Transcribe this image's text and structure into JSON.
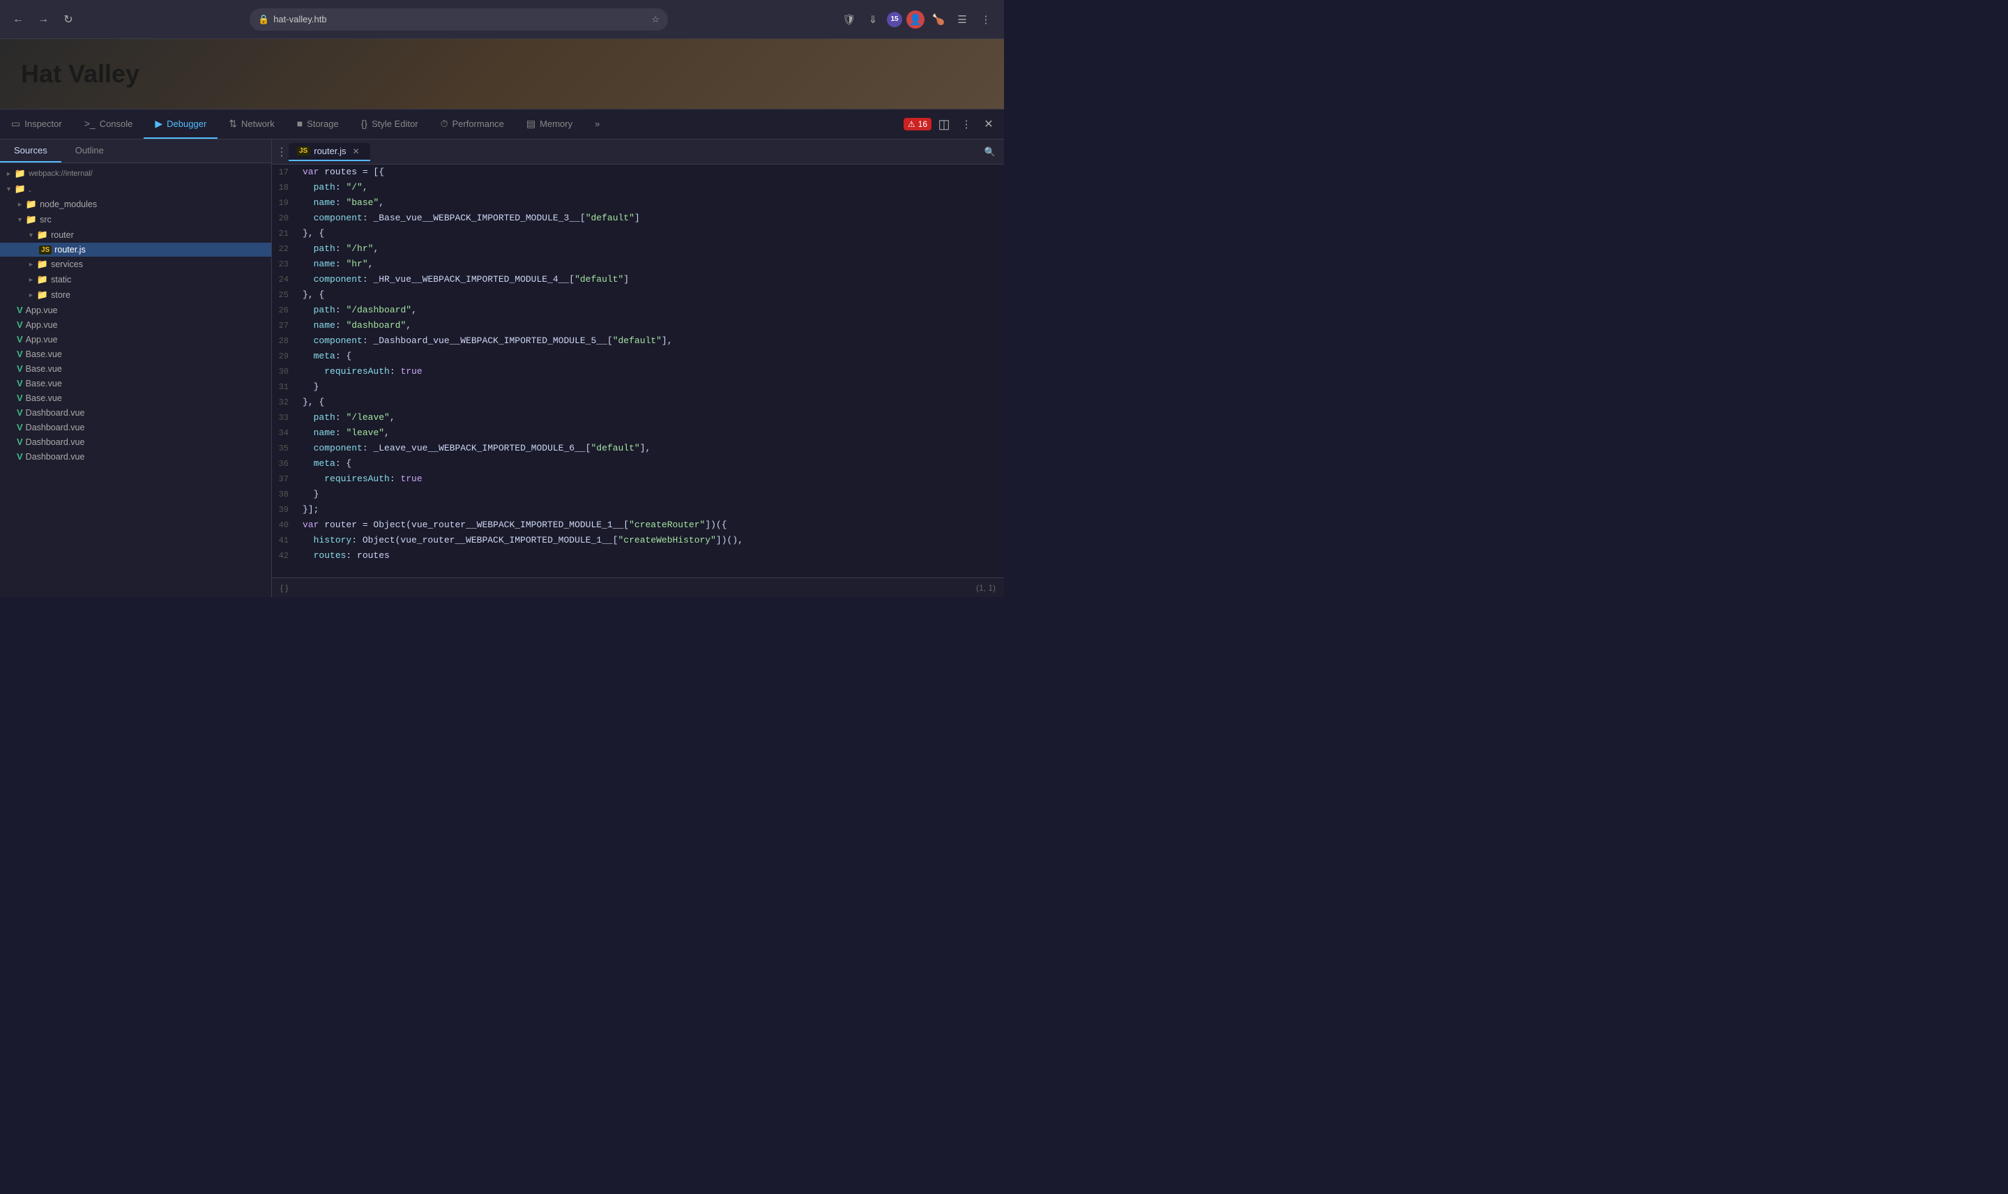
{
  "browser": {
    "url": "hat-valley.htb",
    "back_label": "←",
    "forward_label": "→",
    "reload_label": "↺"
  },
  "website": {
    "title": "Hat Valley"
  },
  "devtools": {
    "tabs": [
      {
        "id": "inspector",
        "label": "Inspector",
        "icon": "☐"
      },
      {
        "id": "console",
        "label": "Console",
        "icon": "⬚"
      },
      {
        "id": "debugger",
        "label": "Debugger",
        "icon": "▷",
        "active": true
      },
      {
        "id": "network",
        "label": "Network",
        "icon": "⬡"
      },
      {
        "id": "storage",
        "label": "Storage",
        "icon": "☷"
      },
      {
        "id": "style-editor",
        "label": "Style Editor",
        "icon": "{}"
      },
      {
        "id": "performance",
        "label": "Performance",
        "icon": "⏱"
      },
      {
        "id": "memory",
        "label": "Memory",
        "icon": "☰"
      },
      {
        "id": "more",
        "label": "»",
        "icon": ""
      }
    ],
    "error_count": "16",
    "sidebar_tabs": [
      {
        "id": "sources",
        "label": "Sources",
        "active": true
      },
      {
        "id": "outline",
        "label": "Outline"
      }
    ],
    "file_tree": [
      {
        "id": "webpack-internal",
        "label": "webpack://internal/",
        "type": "folder",
        "depth": 0,
        "expanded": false,
        "truncated": true
      },
      {
        "id": "dot",
        "label": ".",
        "type": "folder",
        "depth": 0,
        "expanded": true
      },
      {
        "id": "node-modules",
        "label": "node_modules",
        "type": "folder",
        "depth": 1,
        "expanded": false
      },
      {
        "id": "src",
        "label": "src",
        "type": "folder",
        "depth": 1,
        "expanded": true
      },
      {
        "id": "router",
        "label": "router",
        "type": "folder",
        "depth": 2,
        "expanded": true
      },
      {
        "id": "router-js",
        "label": "router.js",
        "type": "js",
        "depth": 3,
        "selected": true
      },
      {
        "id": "services",
        "label": "services",
        "type": "folder",
        "depth": 2,
        "expanded": false
      },
      {
        "id": "static",
        "label": "static",
        "type": "folder",
        "depth": 2,
        "expanded": false
      },
      {
        "id": "store",
        "label": "store",
        "type": "folder",
        "depth": 2,
        "expanded": false
      },
      {
        "id": "app-vue-1",
        "label": "App.vue",
        "type": "vue",
        "depth": 1
      },
      {
        "id": "app-vue-2",
        "label": "App.vue",
        "type": "vue",
        "depth": 1
      },
      {
        "id": "app-vue-3",
        "label": "App.vue",
        "type": "vue",
        "depth": 1
      },
      {
        "id": "base-vue-1",
        "label": "Base.vue",
        "type": "vue",
        "depth": 1
      },
      {
        "id": "base-vue-2",
        "label": "Base.vue",
        "type": "vue",
        "depth": 1
      },
      {
        "id": "base-vue-3",
        "label": "Base.vue",
        "type": "vue",
        "depth": 1
      },
      {
        "id": "base-vue-4",
        "label": "Base.vue",
        "type": "vue",
        "depth": 1
      },
      {
        "id": "dashboard-vue-1",
        "label": "Dashboard.vue",
        "type": "vue",
        "depth": 1
      },
      {
        "id": "dashboard-vue-2",
        "label": "Dashboard.vue",
        "type": "vue",
        "depth": 1
      },
      {
        "id": "dashboard-vue-3",
        "label": "Dashboard.vue",
        "type": "vue",
        "depth": 1
      },
      {
        "id": "dashboard-vue-4",
        "label": "Dashboard.vue",
        "type": "vue",
        "depth": 1
      }
    ],
    "active_file": "router.js",
    "status_position": "(1, 1)"
  },
  "code": {
    "lines": [
      {
        "num": "17",
        "html": "<span class='kw'>var</span> routes = [{"
      },
      {
        "num": "18",
        "html": "  <span class='prop'>path</span>: <span class='str'>\"/\"</span>,"
      },
      {
        "num": "19",
        "html": "  <span class='prop'>name</span>: <span class='str'>\"base\"</span>,"
      },
      {
        "num": "20",
        "html": "  <span class='prop'>component</span>: _Base_vue__WEBPACK_IMPORTED_MODULE_3__[<span class='str'>\"default\"</span>]"
      },
      {
        "num": "21",
        "html": "}, {"
      },
      {
        "num": "22",
        "html": "  <span class='prop'>path</span>: <span class='str'>\"/hr\"</span>,"
      },
      {
        "num": "23",
        "html": "  <span class='prop'>name</span>: <span class='str'>\"hr\"</span>,"
      },
      {
        "num": "24",
        "html": "  <span class='prop'>component</span>: _HR_vue__WEBPACK_IMPORTED_MODULE_4__[<span class='str'>\"default\"</span>]"
      },
      {
        "num": "25",
        "html": "}, {"
      },
      {
        "num": "26",
        "html": "  <span class='prop'>path</span>: <span class='str'>\"/dashboard\"</span>,"
      },
      {
        "num": "27",
        "html": "  <span class='prop'>name</span>: <span class='str'>\"dashboard\"</span>,"
      },
      {
        "num": "28",
        "html": "  <span class='prop'>component</span>: _Dashboard_vue__WEBPACK_IMPORTED_MODULE_5__[<span class='str'>\"default\"</span>],"
      },
      {
        "num": "29",
        "html": "  <span class='prop'>meta</span>: {"
      },
      {
        "num": "30",
        "html": "    <span class='prop'>requiresAuth</span>: <span class='bool'>true</span>"
      },
      {
        "num": "31",
        "html": "  }"
      },
      {
        "num": "32",
        "html": "}, {"
      },
      {
        "num": "33",
        "html": "  <span class='prop'>path</span>: <span class='str'>\"/leave\"</span>,"
      },
      {
        "num": "34",
        "html": "  <span class='prop'>name</span>: <span class='str'>\"leave\"</span>,"
      },
      {
        "num": "35",
        "html": "  <span class='prop'>component</span>: _Leave_vue__WEBPACK_IMPORTED_MODULE_6__[<span class='str'>\"default\"</span>],"
      },
      {
        "num": "36",
        "html": "  <span class='prop'>meta</span>: {"
      },
      {
        "num": "37",
        "html": "    <span class='prop'>requiresAuth</span>: <span class='bool'>true</span>"
      },
      {
        "num": "38",
        "html": "  }"
      },
      {
        "num": "39",
        "html": "}];"
      },
      {
        "num": "40",
        "html": "<span class='kw'>var</span> router = Object(vue_router__WEBPACK_IMPORTED_MODULE_1__[<span class='str'>\"createRouter\"</span>])({"
      },
      {
        "num": "41",
        "html": "  <span class='prop'>history</span>: Object(vue_router__WEBPACK_IMPORTED_MODULE_1__[<span class='str'>\"createWebHistory\"</span>])(),"
      },
      {
        "num": "42",
        "html": "  <span class='prop'>routes</span>: routes"
      }
    ],
    "status_icons": [
      "{ }"
    ]
  }
}
